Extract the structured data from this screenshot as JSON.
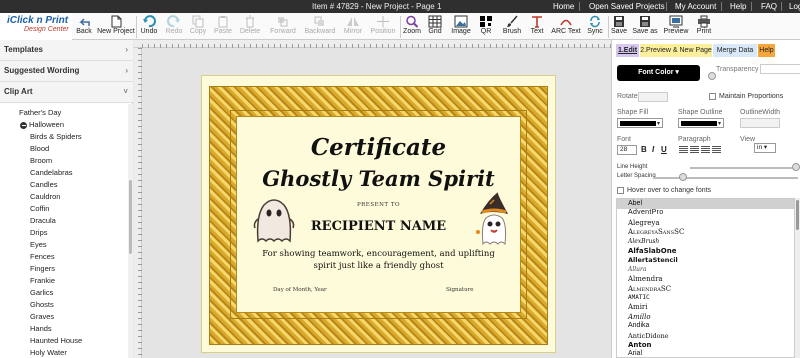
{
  "topbar": {
    "item_title": "Item # 47829 - New Project - Page 1",
    "links": [
      "Home",
      "Open Saved Projects",
      "My Account",
      "Help",
      "FAQ",
      "Log"
    ]
  },
  "logo": {
    "line1": "iClick n Print",
    "line2": "Design Center"
  },
  "toolbar": {
    "tools": [
      {
        "label": "Back",
        "icon": "back-arrow-icon",
        "enabled": true
      },
      {
        "label": "New Project",
        "icon": "new-project-icon",
        "enabled": true
      },
      {
        "label": "Undo",
        "icon": "undo-icon",
        "enabled": true
      },
      {
        "label": "Redo",
        "icon": "redo-icon",
        "enabled": false
      },
      {
        "label": "Copy",
        "icon": "copy-icon",
        "enabled": false
      },
      {
        "label": "Paste",
        "icon": "paste-icon",
        "enabled": false
      },
      {
        "label": "Delete",
        "icon": "delete-icon",
        "enabled": false
      },
      {
        "label": "Forward",
        "icon": "forward-icon",
        "enabled": false
      },
      {
        "label": "Backward",
        "icon": "backward-icon",
        "enabled": false
      },
      {
        "label": "Mirror",
        "icon": "mirror-icon",
        "enabled": false
      },
      {
        "label": "Position",
        "icon": "position-icon",
        "enabled": false
      },
      {
        "label": "Zoom",
        "icon": "zoom-icon",
        "enabled": true
      },
      {
        "label": "Grid",
        "icon": "grid-icon",
        "enabled": true
      },
      {
        "label": "Image",
        "icon": "image-icon",
        "enabled": true
      },
      {
        "label": "QR",
        "icon": "qr-icon",
        "enabled": true
      },
      {
        "label": "Brush",
        "icon": "brush-icon",
        "enabled": true
      },
      {
        "label": "Text",
        "icon": "text-icon",
        "enabled": true
      },
      {
        "label": "ARC Text",
        "icon": "arc-text-icon",
        "enabled": true
      },
      {
        "label": "Sync",
        "icon": "sync-icon",
        "enabled": true
      },
      {
        "label": "Save",
        "icon": "save-icon",
        "enabled": true
      },
      {
        "label": "Save as",
        "icon": "save-as-icon",
        "enabled": true
      },
      {
        "label": "Preview",
        "icon": "preview-icon",
        "enabled": true
      },
      {
        "label": "Print",
        "icon": "print-icon",
        "enabled": true
      }
    ]
  },
  "sidebar": {
    "sections": [
      {
        "label": "Templates",
        "expanded": false
      },
      {
        "label": "Suggested Wording",
        "expanded": false
      },
      {
        "label": "Clip Art",
        "expanded": true
      }
    ],
    "tree_parents": [
      "Father's Day",
      "Halloween"
    ],
    "tree_children": [
      "Birds & Spiders",
      "Blood",
      "Broom",
      "Candelabras",
      "Candles",
      "Cauldron",
      "Coffin",
      "Dracula",
      "Drips",
      "Eyes",
      "Fences",
      "Fingers",
      "Frankie",
      "Garlics",
      "Ghosts",
      "Graves",
      "Hands",
      "Haunted House",
      "Holy Water"
    ]
  },
  "certificate": {
    "title_line1": "Certificate",
    "title_line2": "Ghostly Team Spirit",
    "present_to": "PRESENT TO",
    "recipient": "RECIPIENT NAME",
    "body": "For showing teamwork, encouragement, and uplifting spirit just like a friendly ghost",
    "date_label": "Day of Month, Year",
    "signature_label": "Signature"
  },
  "right_panel": {
    "tabs": [
      "1.Edit",
      "2.Preview & New Page",
      "Merge Data",
      "Help"
    ],
    "font_color_button": "Font Color",
    "transparency_label": "Transparency",
    "rotate_label": "Rotate",
    "maintain_proportions_label": "Maintain Proportions",
    "shape_fill_label": "Shape Fill",
    "shape_outline_label": "Shape Outline",
    "outline_width_label": "OutlineWidth",
    "font_label": "Font",
    "paragraph_label": "Paragraph",
    "view_label": "View",
    "font_size_value": "28",
    "bold_label": "B",
    "italic_label": "I",
    "underline_label": "U",
    "view_value": "in",
    "line_height_label": "Line Height",
    "letter_spacing_label": "Letter Spacing",
    "hover_label": "Hover over to change fonts",
    "fonts": [
      "Abel",
      "AdventPro",
      "Alegreya",
      "AlegreyaSansSC",
      "AlexBrush",
      "AlfaSlabOne",
      "AllertaStencil",
      "Allura",
      "Almendra",
      "AlmendraSC",
      "AMATIC",
      "Amiri",
      "Amillo",
      "Andika",
      "AnticDidone",
      "Anton",
      "Arial"
    ],
    "colors": {
      "fill": "#000000",
      "outline": "#000000",
      "accent": "#f7a63c"
    }
  }
}
